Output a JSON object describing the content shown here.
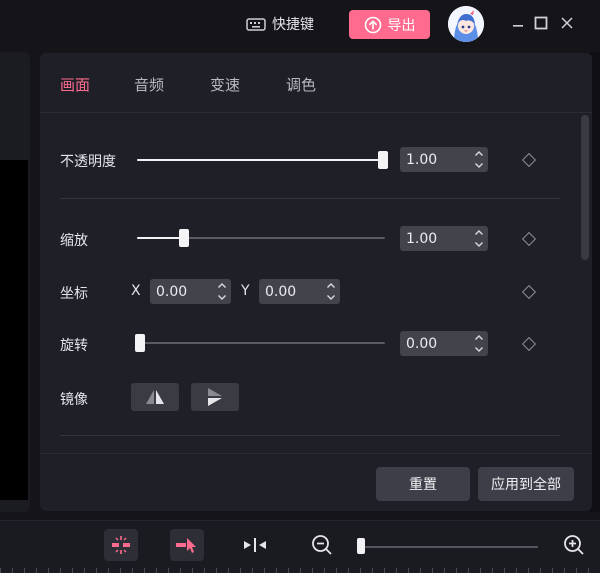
{
  "titlebar": {
    "shortcut_icon": "keyboard-icon",
    "shortcut_label": "快捷键",
    "export_icon": "upload-icon",
    "export_label": "导出",
    "export_color": "#fe6b8e"
  },
  "panel": {
    "tabs": [
      {
        "label": "画面",
        "active": true
      },
      {
        "label": "音频",
        "active": false
      },
      {
        "label": "变速",
        "active": false
      },
      {
        "label": "调色",
        "active": false
      }
    ],
    "opacity": {
      "label": "不透明度",
      "value": "1.00",
      "level": 1.0
    },
    "scale": {
      "label": "缩放",
      "value": "1.00",
      "level": 0.19
    },
    "position": {
      "label": "坐标",
      "x_label": "X",
      "x_value": "0.00",
      "y_label": "Y",
      "y_value": "0.00"
    },
    "rotation": {
      "label": "旋转",
      "value": "0.00",
      "level": 0.0
    },
    "mirror": {
      "label": "镜像",
      "icons": [
        "mirror-horizontal-icon",
        "mirror-vertical-icon"
      ]
    },
    "footer": {
      "reset_label": "重置",
      "apply_all_label": "应用到全部"
    }
  },
  "toolbar": {
    "icons": [
      "split-icon",
      "select-cursor-icon",
      "snap-icon",
      "zoom-out-icon",
      "zoom-in-icon"
    ],
    "zoom_level": 0.0
  },
  "colors": {
    "accent": "#fe6b8e",
    "panel_bg": "#1f1f27",
    "app_bg": "#141419"
  }
}
